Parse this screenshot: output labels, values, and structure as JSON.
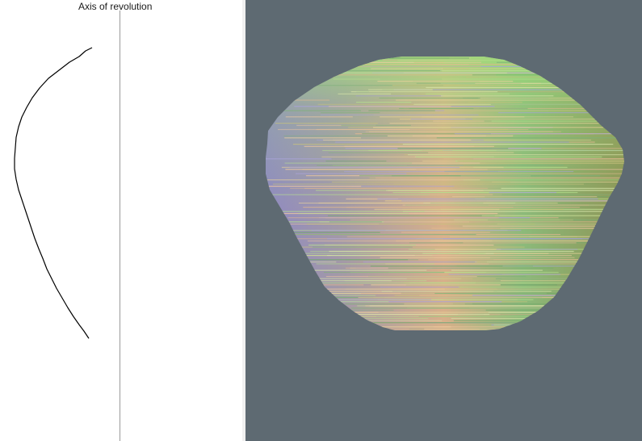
{
  "profile_panel": {
    "axis_label": "Axis of revolution"
  },
  "viewport": {
    "background_color": "#5e6a72",
    "model": "vase-surface-of-revolution"
  },
  "colors": {
    "profile_curve": "#000000",
    "axis_line": "#9a9a9a",
    "vase_base": "#8e8a78",
    "vase_shade_left": "#8a86c8",
    "vase_shade_center": "#d8b08a",
    "vase_shade_right": "#8e8e50",
    "vase_highlight_green": "#9ee07a"
  }
}
